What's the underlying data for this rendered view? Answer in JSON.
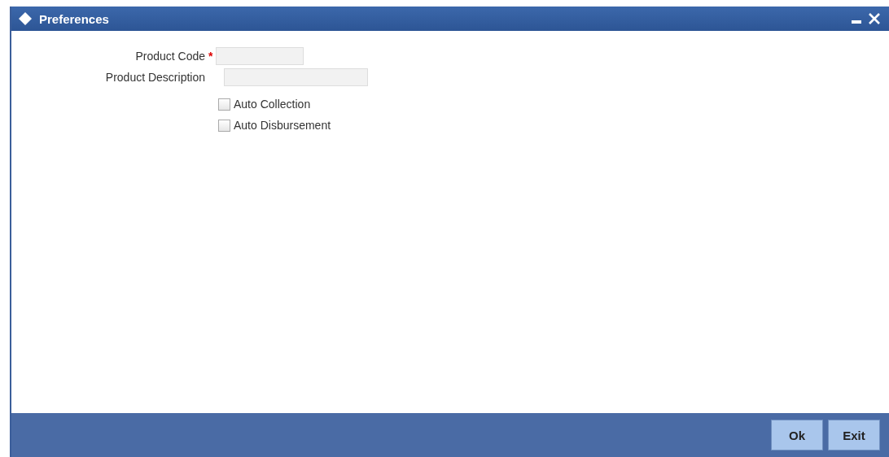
{
  "window": {
    "title": "Preferences"
  },
  "fields": [
    {
      "label": "Product Code",
      "required": true
    },
    {
      "label": "Product Description",
      "required": false
    }
  ],
  "required_mark": "*",
  "checkboxes": [
    {
      "label": "Auto Collection",
      "checked": false
    },
    {
      "label": "Auto Disbursement",
      "checked": false
    }
  ],
  "buttons": [
    "Ok",
    "Exit"
  ]
}
